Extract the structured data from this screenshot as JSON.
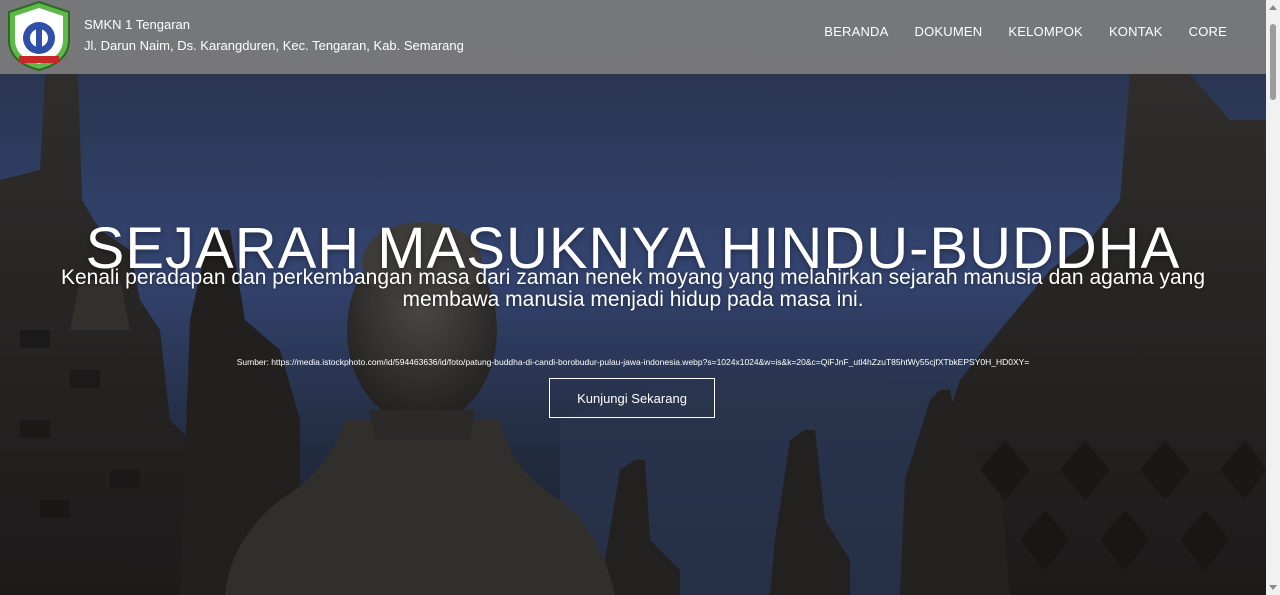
{
  "header": {
    "school_name": "SMKN 1 Tengaran",
    "school_address": "Jl. Darun Naim, Ds. Karangduren, Kec. Tengaran, Kab. Semarang",
    "logo_icon": "smk-negeri-emblem",
    "logo_text": "SMK NEGERI"
  },
  "nav": {
    "items": [
      {
        "label": "BERANDA"
      },
      {
        "label": "DOKUMEN"
      },
      {
        "label": "KELOMPOK"
      },
      {
        "label": "KONTAK"
      },
      {
        "label": "CORE"
      }
    ]
  },
  "hero": {
    "title": "SEJARAH MASUKNYA HINDU-BUDDHA",
    "subtitle": "Kenali peradapan dan perkembangan masa dari zaman nenek moyang yang melahirkan sejarah manusia dan agama yang membawa manusia menjadi hidup pada masa ini.",
    "source": "Sumber: https://media.istockphoto.com/id/594463636/id/foto/patung-buddha-di-candi-borobudur-pulau-jawa-indonesia.webp?s=1024x1024&w=is&k=20&c=QiFJnF_utl4hZzuT85htWy55cjfXTbkEPSY0H_HD0XY=",
    "cta_label": "Kunjungi Sekarang"
  },
  "colors": {
    "navbar_bg": "#7d7d7d",
    "text": "#ffffff",
    "hero_sky": "#3d4f7a"
  }
}
